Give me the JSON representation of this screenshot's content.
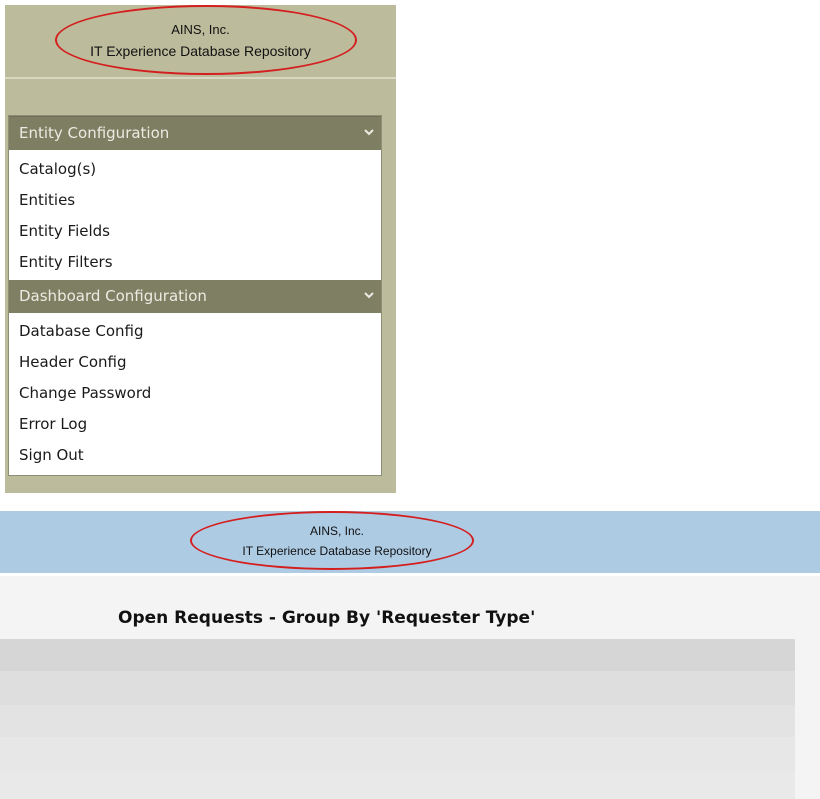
{
  "sidebar_panel": {
    "company": "AINS, Inc.",
    "app_title": "IT Experience Database Repository",
    "groups": [
      {
        "label": "Entity Configuration",
        "items": [
          "Catalog(s)",
          "Entities",
          "Entity Fields",
          "Entity Filters"
        ]
      },
      {
        "label": "Dashboard Configuration",
        "items": [
          "Database Config",
          "Header Config",
          "Change Password",
          "Error Log",
          "Sign Out"
        ]
      }
    ]
  },
  "dashboard": {
    "company": "AINS, Inc.",
    "app_title": "IT Experience Database Repository",
    "report_title": "Open Requests - Group By 'Requester Type'"
  },
  "colors": {
    "panel_bg": "#bcbb9c",
    "group_header_bg": "#7f7f64",
    "banner_bg": "#aecbe4",
    "highlight_oval": "#d41f1f"
  },
  "icons": {
    "group_toggle": "chevron-down-icon"
  }
}
